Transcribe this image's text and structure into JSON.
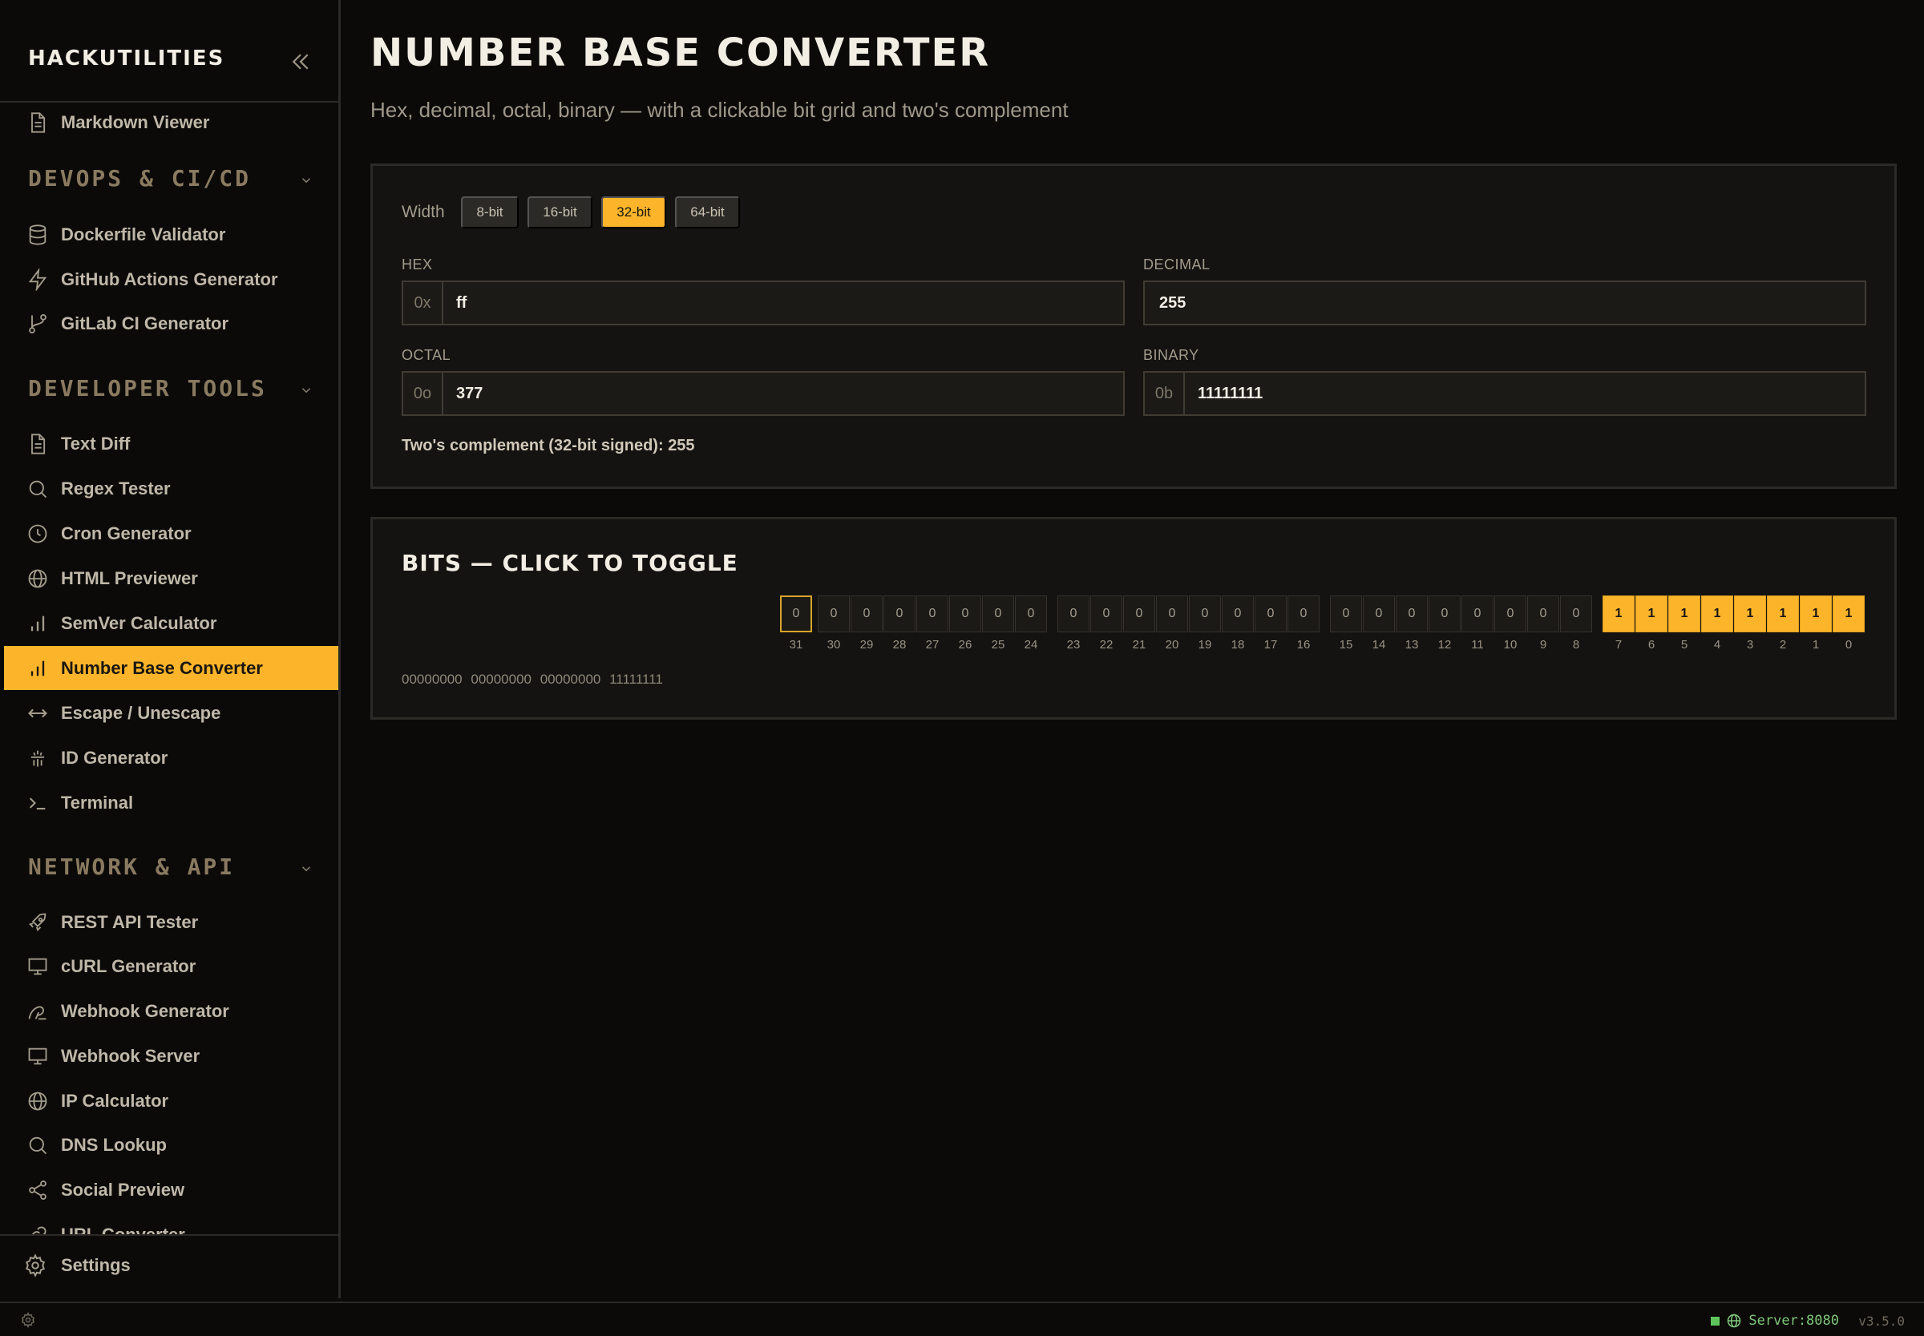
{
  "app": {
    "brand": "HACKUTILITIES"
  },
  "sidebar": {
    "top_items": [
      {
        "label": "Markdown Viewer",
        "icon": "file-icon"
      }
    ],
    "sections": [
      {
        "title": "DEVOPS & CI/CD",
        "items": [
          {
            "label": "Dockerfile Validator",
            "icon": "database-icon"
          },
          {
            "label": "GitHub Actions Generator",
            "icon": "bolt-icon"
          },
          {
            "label": "GitLab CI Generator",
            "icon": "git-branch-icon"
          }
        ]
      },
      {
        "title": "DEVELOPER TOOLS",
        "items": [
          {
            "label": "Text Diff",
            "icon": "file-icon"
          },
          {
            "label": "Regex Tester",
            "icon": "search-icon"
          },
          {
            "label": "Cron Generator",
            "icon": "clock-icon"
          },
          {
            "label": "HTML Previewer",
            "icon": "globe-icon"
          },
          {
            "label": "SemVer Calculator",
            "icon": "bar-chart-icon"
          },
          {
            "label": "Number Base Converter",
            "icon": "bar-chart-icon",
            "active": true
          },
          {
            "label": "Escape / Unescape",
            "icon": "arrows-icon"
          },
          {
            "label": "ID Generator",
            "icon": "fingerprint-icon"
          },
          {
            "label": "Terminal",
            "icon": "terminal-icon"
          }
        ]
      },
      {
        "title": "NETWORK & API",
        "items": [
          {
            "label": "REST API Tester",
            "icon": "rocket-icon"
          },
          {
            "label": "cURL Generator",
            "icon": "monitor-icon"
          },
          {
            "label": "Webhook Generator",
            "icon": "webhook-icon"
          },
          {
            "label": "Webhook Server",
            "icon": "monitor-icon"
          },
          {
            "label": "IP Calculator",
            "icon": "globe-icon"
          },
          {
            "label": "DNS Lookup",
            "icon": "search-icon"
          },
          {
            "label": "Social Preview",
            "icon": "share-icon"
          },
          {
            "label": "URL Converter",
            "icon": "link-icon"
          }
        ]
      }
    ],
    "settings_label": "Settings"
  },
  "page": {
    "title": "NUMBER BASE CONVERTER",
    "subtitle": "Hex, decimal, octal, binary — with a clickable bit grid and two's complement"
  },
  "converter": {
    "width_label": "Width",
    "widths": [
      "8-bit",
      "16-bit",
      "32-bit",
      "64-bit"
    ],
    "selected_width": "32-bit",
    "hex": {
      "label": "HEX",
      "prefix": "0x",
      "value": "ff"
    },
    "decimal": {
      "label": "DECIMAL",
      "value": "255"
    },
    "octal": {
      "label": "OCTAL",
      "prefix": "0o",
      "value": "377"
    },
    "binary": {
      "label": "BINARY",
      "prefix": "0b",
      "value": "11111111"
    },
    "twos_complement": "Two's complement (32-bit signed): 255"
  },
  "bits": {
    "title": "BITS — CLICK TO TOGGLE",
    "values": [
      "0",
      "0",
      "0",
      "0",
      "0",
      "0",
      "0",
      "0",
      "0",
      "0",
      "0",
      "0",
      "0",
      "0",
      "0",
      "0",
      "0",
      "0",
      "0",
      "0",
      "0",
      "0",
      "0",
      "0",
      "1",
      "1",
      "1",
      "1",
      "1",
      "1",
      "1",
      "1"
    ],
    "indices": [
      "31",
      "30",
      "29",
      "28",
      "27",
      "26",
      "25",
      "24",
      "23",
      "22",
      "21",
      "20",
      "19",
      "18",
      "17",
      "16",
      "15",
      "14",
      "13",
      "12",
      "11",
      "10",
      "9",
      "8",
      "7",
      "6",
      "5",
      "4",
      "3",
      "2",
      "1",
      "0"
    ],
    "binary_string": "00000000 00000000 00000000 11111111"
  },
  "footer": {
    "server": "Server:8080",
    "version": "v3.5.0"
  },
  "colors": {
    "accent": "#fcb42a",
    "background": "#0b0a08",
    "panel": "#141311",
    "server_ok": "#5ec45a"
  }
}
